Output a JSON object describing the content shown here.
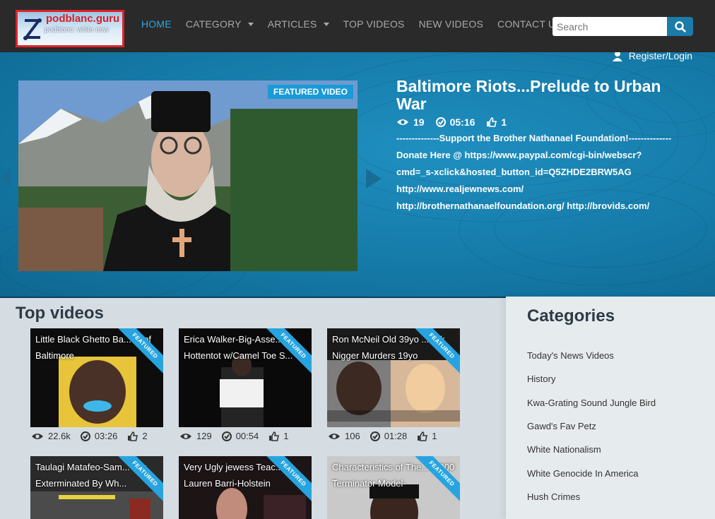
{
  "site": {
    "logo_brand": "podblanc.guru",
    "logo_tagline": "podblanc: white now"
  },
  "nav": {
    "items": [
      {
        "label": "HOME"
      },
      {
        "label": "CATEGORY"
      },
      {
        "label": "ARTICLES"
      },
      {
        "label": "TOP VIDEOS"
      },
      {
        "label": "NEW VIDEOS"
      },
      {
        "label": "CONTACT US"
      }
    ],
    "search_placeholder": "Search"
  },
  "account": {
    "register_label": "Register/Login"
  },
  "featured": {
    "badge": "FEATURED VIDEO",
    "title": "Baltimore Riots...Prelude to Urban War",
    "views": "19",
    "duration": "05:16",
    "likes": "1",
    "description": "--------------Support the Brother Nathanael Foundation!-------------- Donate Here @ https://www.paypal.com/cgi-bin/webscr?cmd=_s-xclick&hosted_button_id=Q5ZHDE2BRW5AG http://www.realjewnews.com/ http://brothernathanaelfoundation.org/ http://brovids.com/"
  },
  "top_videos": {
    "heading": "Top videos",
    "ribbon": "FEATURED",
    "cards": [
      {
        "title": "Little Black Ghetto Ba...ds of Baltimore",
        "views": "22.6k",
        "duration": "03:26",
        "likes": "2"
      },
      {
        "title": "Erica Walker-Big-Asse... Hottentot w/Camel Toe S...",
        "views": "129",
        "duration": "00:54",
        "likes": "1"
      },
      {
        "title": "Ron McNeil Old 39yo ... Dik Nigger Murders 19yo",
        "views": "106",
        "duration": "01:28",
        "likes": "1"
      },
      {
        "title": "Taulagi Matafeo-Sam... Mix Exterminated By Wh...",
        "views": "",
        "duration": "",
        "likes": ""
      },
      {
        "title": "Very Ugly jewess Teac... Lauren Barri-Holstein",
        "views": "",
        "duration": "",
        "likes": ""
      },
      {
        "title": "Characteristics of The... 1,000 Terminator Model-",
        "views": "",
        "duration": "",
        "likes": ""
      }
    ]
  },
  "categories": {
    "heading": "Categories",
    "items": [
      "Today's News Videos",
      "History",
      "Kwa-Grating Sound Jungle Bird",
      "Gawd's Fav Petz",
      "White Nationalism",
      "White Genocide In America",
      "Hush Crimes"
    ]
  },
  "colors": {
    "accent": "#29a7e1",
    "hero_bg": "#157aa8",
    "nav_bg": "#2a2a2a",
    "ribbon": "#27a4df"
  }
}
